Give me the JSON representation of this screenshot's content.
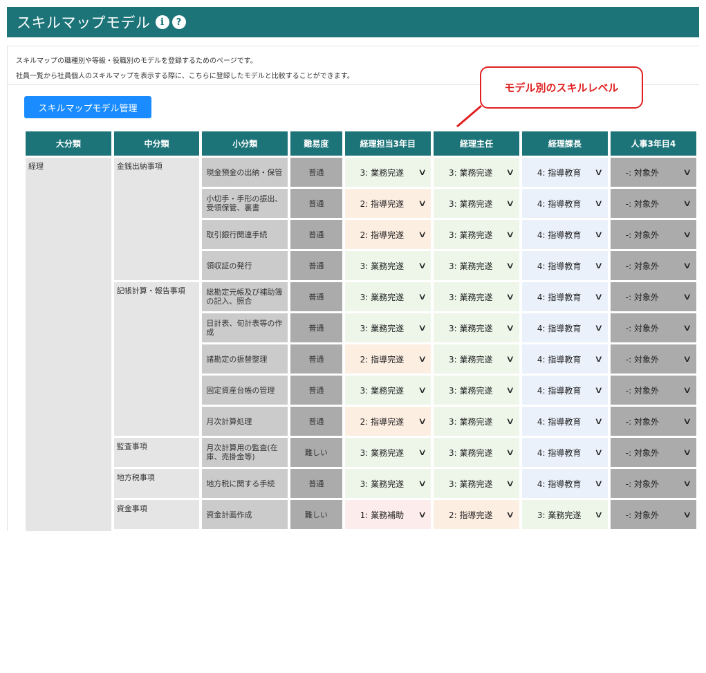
{
  "header": {
    "title": "スキルマップモデル",
    "info_glyph": "i",
    "help_glyph": "?"
  },
  "description": {
    "line1": "スキルマップの職種別や等級・役職別のモデルを登録するためのページです。",
    "line2": "社員一覧から社員個人のスキルマップを表示する際に、こちらに登録したモデルと比較することができます。"
  },
  "manage_button": "スキルマップモデル管理",
  "callout": "モデル別のスキルレベル",
  "table": {
    "headers": [
      "大分類",
      "中分類",
      "小分類",
      "難易度",
      "経理担当3年目",
      "経理主任",
      "経理課長",
      "人事3年目4"
    ],
    "large": "経理",
    "groups": [
      {
        "mid": "金銭出納事項",
        "rows": [
          {
            "small": "現金預金の出納・保管",
            "difficulty": "普通",
            "levels": [
              "3: 業務完遂",
              "3: 業務完遂",
              "4: 指導教育",
              "-: 対象外"
            ]
          },
          {
            "small": "小切手・手形の振出、受領保管、裏書",
            "difficulty": "普通",
            "levels": [
              "2: 指導完遂",
              "3: 業務完遂",
              "4: 指導教育",
              "-: 対象外"
            ]
          },
          {
            "small": "取引銀行関連手続",
            "difficulty": "普通",
            "levels": [
              "2: 指導完遂",
              "3: 業務完遂",
              "4: 指導教育",
              "-: 対象外"
            ]
          },
          {
            "small": "領収証の発行",
            "difficulty": "普通",
            "levels": [
              "3: 業務完遂",
              "3: 業務完遂",
              "4: 指導教育",
              "-: 対象外"
            ]
          }
        ]
      },
      {
        "mid": "記帳計算・報告事項",
        "rows": [
          {
            "small": "総勘定元帳及び補助簿の記入、照合",
            "difficulty": "普通",
            "levels": [
              "3: 業務完遂",
              "3: 業務完遂",
              "4: 指導教育",
              "-: 対象外"
            ]
          },
          {
            "small": "日計表、旬計表等の作成",
            "difficulty": "普通",
            "levels": [
              "3: 業務完遂",
              "3: 業務完遂",
              "4: 指導教育",
              "-: 対象外"
            ]
          },
          {
            "small": "諸勘定の振替整理",
            "difficulty": "普通",
            "levels": [
              "2: 指導完遂",
              "3: 業務完遂",
              "4: 指導教育",
              "-: 対象外"
            ]
          },
          {
            "small": "固定資産台帳の管理",
            "difficulty": "普通",
            "levels": [
              "3: 業務完遂",
              "3: 業務完遂",
              "4: 指導教育",
              "-: 対象外"
            ]
          },
          {
            "small": "月次計算処理",
            "difficulty": "普通",
            "levels": [
              "2: 指導完遂",
              "3: 業務完遂",
              "4: 指導教育",
              "-: 対象外"
            ]
          }
        ]
      },
      {
        "mid": "監査事項",
        "rows": [
          {
            "small": "月次計算用の監査(在庫、売掛金等)",
            "difficulty": "難しい",
            "levels": [
              "3: 業務完遂",
              "3: 業務完遂",
              "4: 指導教育",
              "-: 対象外"
            ]
          }
        ]
      },
      {
        "mid": "地方税事項",
        "rows": [
          {
            "small": "地方税に関する手続",
            "difficulty": "普通",
            "levels": [
              "3: 業務完遂",
              "3: 業務完遂",
              "4: 指導教育",
              "-: 対象外"
            ]
          }
        ]
      },
      {
        "mid": "資金事項",
        "rows": [
          {
            "small": "資金計画作成",
            "difficulty": "難しい",
            "levels": [
              "1: 業務補助",
              "2: 指導完遂",
              "3: 業務完遂",
              "-: 対象外"
            ]
          }
        ]
      }
    ]
  },
  "colors": {
    "header_teal": "#1c7479",
    "button_blue": "#1a8cff",
    "callout_red": "#e02020",
    "level_1": "#fdecec",
    "level_2": "#fdeee2",
    "level_3": "#eef6ea",
    "level_4": "#eaf1fb",
    "level_none": "#ababab"
  }
}
